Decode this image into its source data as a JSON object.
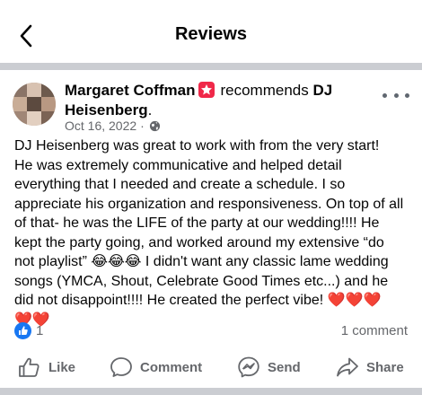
{
  "header": {
    "title": "Reviews"
  },
  "post": {
    "author": "Margaret Coffman",
    "recommends_word": "recommends",
    "page_name": "DJ Heisenberg",
    "page_suffix": ".",
    "date": "Oct 16, 2022",
    "separator": "·",
    "privacy_icon": "globe-icon",
    "body": [
      "DJ Heisenberg was great to work with from the very start!",
      "He was extremely communicative and helped detail",
      "everything that I needed and create a schedule. I so",
      "appreciate his organization and responsiveness. On top of all",
      "of that- he was the LIFE of the party at our wedding!!!! He",
      "kept the party going, and worked around my extensive “do",
      "not playlist” 😂😂😂 I didn't want any classic lame wedding",
      "songs (YMCA, Shout, Celebrate Good Times etc...) and he",
      "did not disappoint!!!! He created the perfect vibe! ❤️❤️❤️",
      "❤️❤️"
    ]
  },
  "stats": {
    "likes": "1",
    "comments": "1 comment"
  },
  "actions": {
    "like": "Like",
    "comment": "Comment",
    "send": "Send",
    "share": "Share"
  },
  "colors": {
    "accent": "#1877f2",
    "badge": "#f02849",
    "muted_text": "#65676b",
    "divider": "#cbcdd2"
  }
}
